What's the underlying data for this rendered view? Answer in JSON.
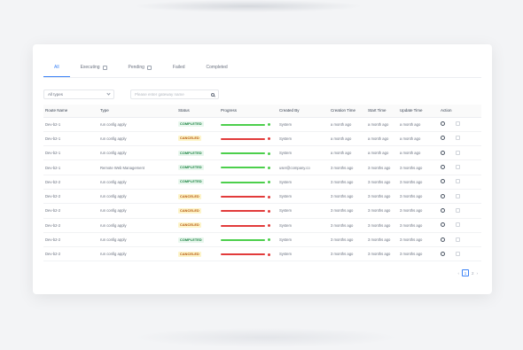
{
  "tabs": [
    {
      "label": "All",
      "active": true,
      "icon": ""
    },
    {
      "label": "Executing",
      "active": false,
      "icon": "list-icon"
    },
    {
      "label": "Pending",
      "active": false,
      "icon": "list-icon"
    },
    {
      "label": "Failed",
      "active": false,
      "icon": ""
    },
    {
      "label": "Completed",
      "active": false,
      "icon": ""
    }
  ],
  "filters": {
    "type_select": "All types",
    "search_placeholder": "Please enter gateway name"
  },
  "columns": [
    "Route Name",
    "Type",
    "Status",
    "Progress",
    "Created By",
    "Creation Time",
    "Start Time",
    "Update Time",
    "Action"
  ],
  "rows": [
    {
      "route": "Dev-b2-1",
      "type": "run config apply",
      "status": "COMPLETED",
      "progress": "ok",
      "created_by": "System",
      "creation": "a month ago",
      "start": "a month ago",
      "update": "a month ago"
    },
    {
      "route": "Dev-b2-1",
      "type": "run config apply",
      "status": "CANCELED",
      "progress": "bad",
      "created_by": "System",
      "creation": "a month ago",
      "start": "a month ago",
      "update": "a month ago"
    },
    {
      "route": "Dev-b2-1",
      "type": "run config apply",
      "status": "COMPLETED",
      "progress": "ok",
      "created_by": "System",
      "creation": "a month ago",
      "start": "a month ago",
      "update": "a month ago"
    },
    {
      "route": "Dev-b2-1",
      "type": "Remote Web Management",
      "status": "COMPLETED",
      "progress": "ok",
      "created_by": "user@company.co",
      "creation": "3 months ago",
      "start": "3 months ago",
      "update": "3 months ago"
    },
    {
      "route": "Dev-b2-2",
      "type": "run config apply",
      "status": "COMPLETED",
      "progress": "ok",
      "created_by": "System",
      "creation": "3 months ago",
      "start": "3 months ago",
      "update": "3 months ago"
    },
    {
      "route": "Dev-b2-2",
      "type": "run config apply",
      "status": "CANCELED",
      "progress": "bad",
      "created_by": "System",
      "creation": "3 months ago",
      "start": "3 months ago",
      "update": "3 months ago"
    },
    {
      "route": "Dev-b2-2",
      "type": "run config apply",
      "status": "CANCELED",
      "progress": "bad",
      "created_by": "System",
      "creation": "3 months ago",
      "start": "3 months ago",
      "update": "3 months ago"
    },
    {
      "route": "Dev-b2-2",
      "type": "run config apply",
      "status": "CANCELED",
      "progress": "bad",
      "created_by": "System",
      "creation": "3 months ago",
      "start": "3 months ago",
      "update": "3 months ago"
    },
    {
      "route": "Dev-b2-2",
      "type": "run config apply",
      "status": "COMPLETED",
      "progress": "ok",
      "created_by": "System",
      "creation": "3 months ago",
      "start": "3 months ago",
      "update": "3 months ago"
    },
    {
      "route": "Dev-b2-2",
      "type": "run config apply",
      "status": "CANCELED",
      "progress": "bad",
      "created_by": "System",
      "creation": "3 months ago",
      "start": "3 months ago",
      "update": "3 months ago"
    }
  ],
  "pagination": {
    "prev": "‹",
    "current": "1",
    "next_page": "2",
    "next": "›"
  },
  "colors": {
    "accent": "#3b82f6",
    "success": "#4ccf4c",
    "danger": "#e23b3b"
  }
}
